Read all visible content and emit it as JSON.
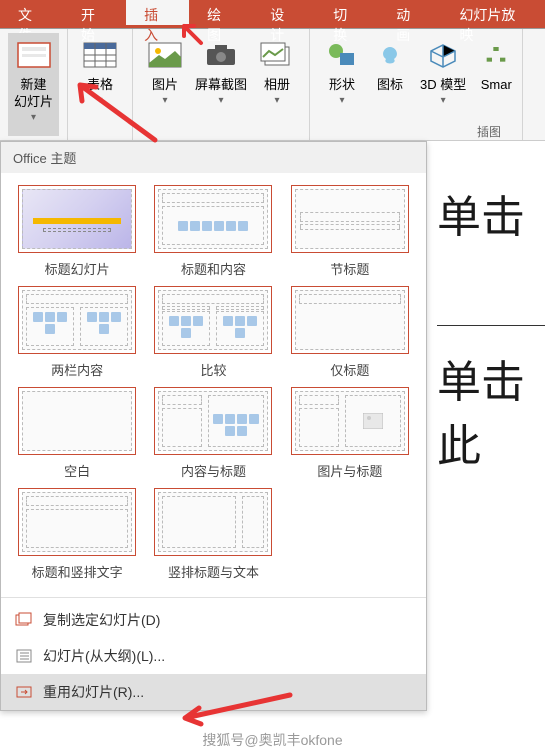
{
  "tabs": {
    "file": "文件",
    "home": "开始",
    "insert": "插入",
    "draw": "绘图",
    "design": "设计",
    "transitions": "切换",
    "animations": "动画",
    "slideshow": "幻灯片放映"
  },
  "ribbon": {
    "new_slide": "新建\n幻灯片",
    "table": "表格",
    "picture": "图片",
    "screenshot": "屏幕截图",
    "album": "相册",
    "shapes": "形状",
    "icons": "图标",
    "model3d": "3D 模型",
    "smart": "Smar",
    "group_illustrations": "插图"
  },
  "dropdown": {
    "header": "Office 主题",
    "layouts": [
      "标题幻灯片",
      "标题和内容",
      "节标题",
      "两栏内容",
      "比较",
      "仅标题",
      "空白",
      "内容与标题",
      "图片与标题",
      "标题和竖排文字",
      "竖排标题与文本"
    ],
    "menu_duplicate": "复制选定幻灯片(D)",
    "menu_outline": "幻灯片(从大纲)(L)...",
    "menu_reuse": "重用幻灯片(R)..."
  },
  "slide": {
    "text1": "单击",
    "text2": "单击此"
  },
  "watermark": "搜狐号@奥凯丰okfone"
}
